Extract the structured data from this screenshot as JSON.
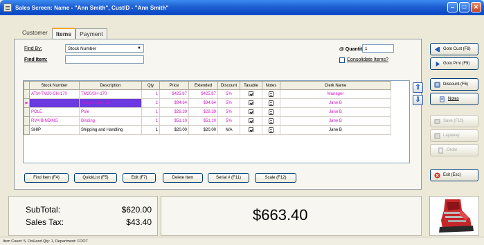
{
  "window": {
    "title": "Sales Screen: Name - \"Ann Smith\", CustID - \"Ann Smith\"",
    "min_icon": "minimize-icon",
    "max_icon": "maximize-icon",
    "close_icon": "close-icon"
  },
  "tabs": [
    {
      "label": "Customer",
      "active": false
    },
    {
      "label": "Items",
      "active": true
    },
    {
      "label": "Payment",
      "active": false
    }
  ],
  "find": {
    "find_by_label": "Find By:",
    "find_by_value": "Stock Number",
    "find_item_label": "Find Item:",
    "find_item_value": "",
    "quantity_label": "@ Quantity",
    "quantity_value": "1",
    "consolidate_label": "Consolidate Items?"
  },
  "table": {
    "columns": [
      "Stock Number",
      "Description",
      "Qty",
      "Price",
      "Extended",
      "Discount",
      "Taxable",
      "Notes",
      "Clerk Name"
    ],
    "rows": [
      {
        "stock": "ATM-TM20-SH-170",
        "desc": "TM20/SH-170",
        "qty": "1",
        "price": "$425.87",
        "ext": "$425.87",
        "disc": "5%",
        "taxable": true,
        "clerk": "Manager",
        "color": "pink",
        "selected": false
      },
      {
        "stock": "",
        "desc": "Scarpa Boot 32",
        "qty": "1",
        "price": "$94.64",
        "ext": "$94.64",
        "disc": "5%",
        "taxable": true,
        "clerk": "Jane B",
        "color": "pink",
        "selected": true
      },
      {
        "stock": "POLE",
        "desc": "Pole",
        "qty": "1",
        "price": "$28.39",
        "ext": "$28.39",
        "disc": "5%",
        "taxable": true,
        "clerk": "Jane B",
        "color": "pink",
        "selected": false
      },
      {
        "stock": "RVA-BINDING",
        "desc": "Binding",
        "qty": "1",
        "price": "$51.10",
        "ext": "$51.10",
        "disc": "5%",
        "taxable": true,
        "clerk": "Jane B",
        "color": "pink",
        "selected": false
      },
      {
        "stock": "SHIP",
        "desc": "Shipping and Handling",
        "qty": "1",
        "price": "$20.00",
        "ext": "$20.00",
        "disc": "N/A",
        "taxable": true,
        "clerk": "Jane B",
        "color": "black",
        "selected": false
      }
    ]
  },
  "bottom_buttons": {
    "find_item": "Find Item (F4)",
    "quicklist": "QuickList (F5)",
    "edit": "Edit (F7)",
    "delete": "Delete Item",
    "serial": "Serial # (F11)",
    "scale": "Scale (F12)"
  },
  "side_buttons": {
    "goto_cust": "Goto Cust (F8)",
    "goto_prnt": "Goto Prnt (F9)",
    "discount": "Discount (F6)",
    "notes": "Notes",
    "save": "Save (F10)",
    "layaway": "Layaway",
    "order": "Order",
    "exit": "Exit (Esc)"
  },
  "totals": {
    "subtotal_label": "SubTotal:",
    "subtotal_value": "$620.00",
    "tax_label": "Sales Tax:",
    "tax_value": "$43.40",
    "grand_total": "$663.40"
  },
  "status": "Item Count: 5,  OnHand Qty: 1,  Department: FOOT",
  "colors": {
    "pink_text": "#d214c8",
    "selection": "#6a39e0",
    "titlebar": "#0a49c6"
  }
}
